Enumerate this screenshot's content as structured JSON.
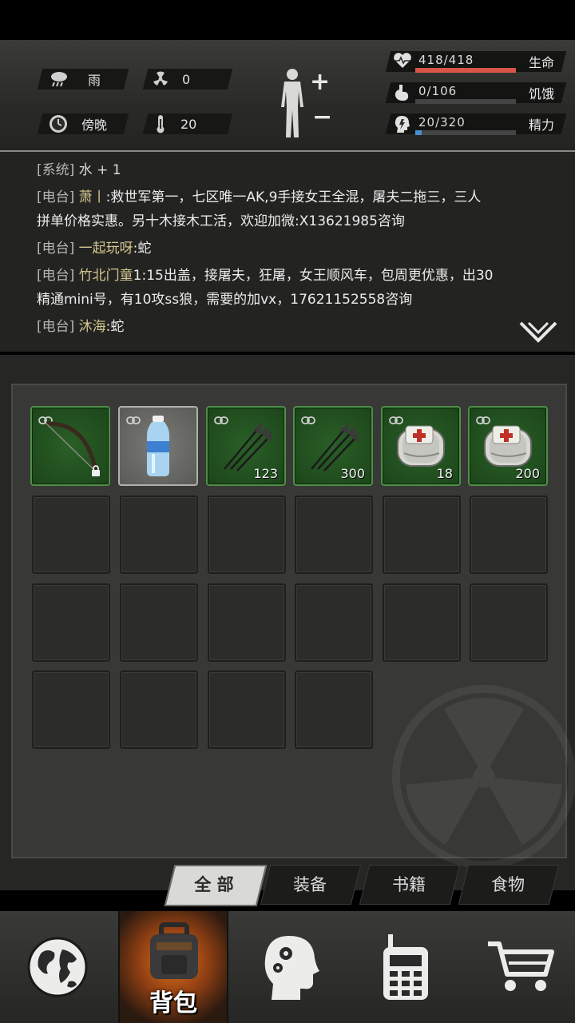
{
  "status": {
    "weather": {
      "icon": "rain-cloud-icon",
      "label": "雨"
    },
    "radiation": {
      "icon": "radiation-icon",
      "value": "0"
    },
    "time": {
      "icon": "clock-icon",
      "label": "傍晚"
    },
    "temperature": {
      "icon": "thermometer-icon",
      "value": "20"
    }
  },
  "vitals": [
    {
      "name": "生命",
      "value": "418/418",
      "fill": 1.0,
      "color": "#d8554a",
      "icon": "heart-pulse-icon"
    },
    {
      "name": "饥饿",
      "value": "0/106",
      "fill": 0.0,
      "color": "#8c8c8c",
      "icon": "stomach-icon"
    },
    {
      "name": "精力",
      "value": "20/320",
      "fill": 0.0625,
      "color": "#4a8ed0",
      "icon": "energy-head-icon"
    }
  ],
  "log": [
    {
      "tag": "[系统]",
      "name": "",
      "text": "水 + 1"
    },
    {
      "tag": "[电台]",
      "name": "萧丨",
      "text": ":救世军第一，七区唯一AK,9手接女王全混，屠夫二拖三，三人"
    },
    {
      "tag": "",
      "name": "",
      "text": "拼单价格实惠。另十木接木工活，欢迎加微:X13621985咨询"
    },
    {
      "tag": "[电台]",
      "name": "一起玩呀",
      "text": ":蛇"
    },
    {
      "tag": "[电台]",
      "name": "竹北门童",
      "text": "1:15出盖，接屠夫，狂屠，女王顺风车，包周更优惠，出30"
    },
    {
      "tag": "",
      "name": "",
      "text": "精通mini号，有10攻ss狼，需要的加vx，17621152558咨询"
    },
    {
      "tag": "[电台]",
      "name": "沐海",
      "text": ":蛇"
    }
  ],
  "inventory": [
    {
      "icon": "bow-icon",
      "count": "",
      "locked": true,
      "style": "green"
    },
    {
      "icon": "water-bottle-icon",
      "count": "",
      "locked": false,
      "style": "grey"
    },
    {
      "icon": "arrows-icon",
      "count": "123",
      "locked": false,
      "style": "green"
    },
    {
      "icon": "arrows-icon",
      "count": "300",
      "locked": false,
      "style": "green"
    },
    {
      "icon": "bandage-icon",
      "count": "18",
      "locked": false,
      "style": "green"
    },
    {
      "icon": "bandage-icon",
      "count": "200",
      "locked": false,
      "style": "green"
    }
  ],
  "tabs": [
    {
      "label": "全 部",
      "active": true
    },
    {
      "label": "装备",
      "active": false
    },
    {
      "label": "书籍",
      "active": false
    },
    {
      "label": "食物",
      "active": false
    }
  ],
  "nav": {
    "items": [
      {
        "icon": "globe-icon"
      },
      {
        "icon": "backpack-icon",
        "label": "背包",
        "active": true
      },
      {
        "icon": "head-gears-icon"
      },
      {
        "icon": "radio-icon"
      },
      {
        "icon": "cart-icon"
      }
    ]
  }
}
